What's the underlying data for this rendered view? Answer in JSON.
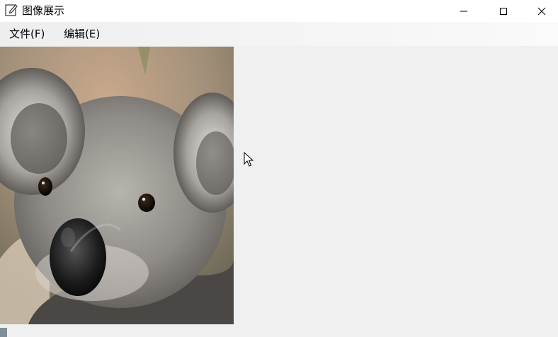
{
  "window": {
    "title": "图像展示",
    "app_icon": "notepad-edit-icon",
    "controls": {
      "minimize_icon": "minimize-icon",
      "maximize_icon": "maximize-icon",
      "close_icon": "close-icon"
    }
  },
  "menu": {
    "file_label": "文件(F)",
    "edit_label": "编辑(E)"
  },
  "content": {
    "image_subject": "koala",
    "image_background_color": "#f0f0f0"
  },
  "cursor": {
    "icon": "arrow-pointer-icon"
  },
  "colors": {
    "titlebar_bg": "#ffffff",
    "window_bg": "#f0f0f0",
    "status_grip": "#7e8f9a"
  }
}
